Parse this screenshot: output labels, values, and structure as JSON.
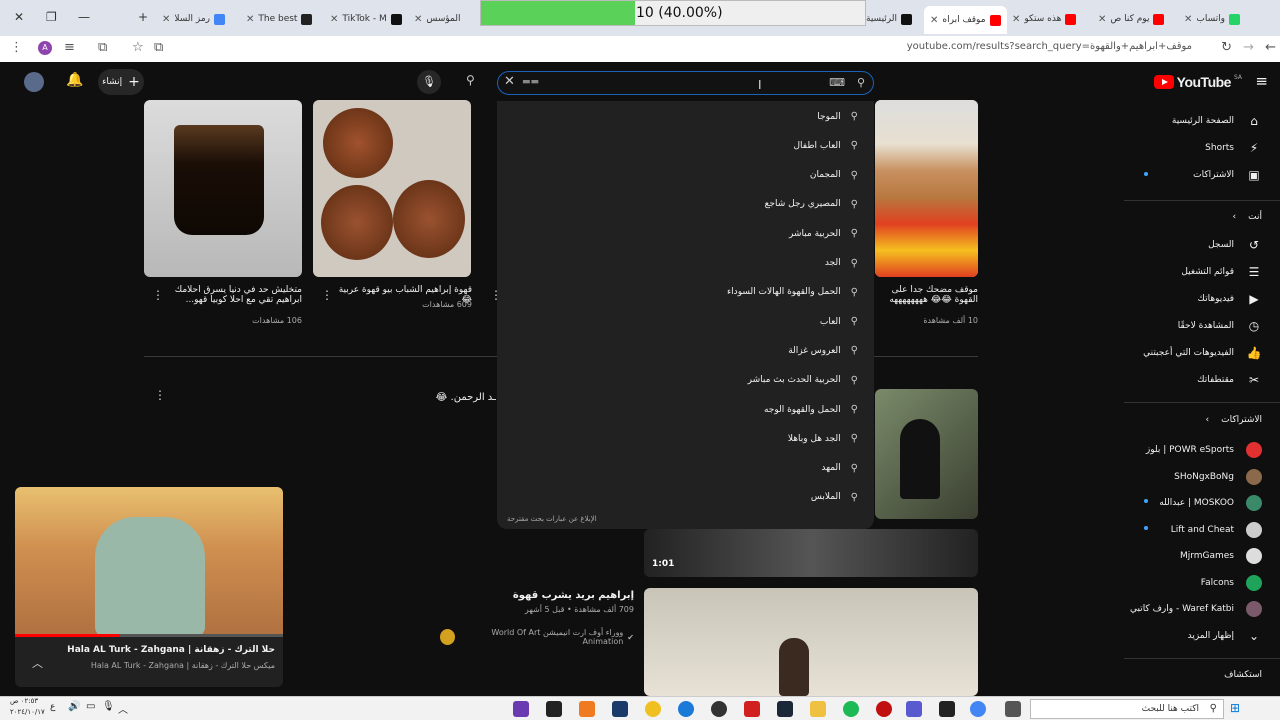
{
  "browser": {
    "tabs": [
      {
        "label": "واتساب",
        "color": "#25d366"
      },
      {
        "label": "يوم كنا ص",
        "color": "#ff0000"
      },
      {
        "label": "هذه ستكو",
        "color": "#ff0000"
      },
      {
        "label": "موقف ابراه",
        "color": "#ff0000"
      },
      {
        "label": "الرئيسية",
        "color": "#000000"
      },
      {
        "label": "المؤسس",
        "color": "#888888"
      },
      {
        "label": "TikTok - M",
        "color": "#000000"
      },
      {
        "label": "The best",
        "color": "#000000"
      },
      {
        "label": "رمز السلا",
        "color": "#4285f4"
      }
    ],
    "progress_text": "10 (40.00%)",
    "progress_value": 0.4,
    "url": "youtube.com/results?search_query=موقف+ابراهيم+والقهوة",
    "profile_initial": "A"
  },
  "header": {
    "logo_text": "YouTube",
    "logo_region": "SA",
    "create_label": "إنشاء",
    "search_value": "▬▬"
  },
  "suggestions": {
    "items": [
      "الموجا",
      "العاب اطفال",
      "المجمان",
      "المصيري رجل شاجع",
      "الحربية مباشر",
      "الجد",
      "الحمل والقهوة الهالات السوداء",
      "العاب",
      "العروس غزالة",
      "الحربية الحدث بث مباشر",
      "الحمل والقهوة الوجه",
      "الجد هل وباهلا",
      "المهد",
      "الملابس"
    ],
    "report_text": "الإبلاغ عن عبارات بحث مقترحة"
  },
  "sidebar": {
    "main": [
      {
        "label": "الصفحة الرئيسية",
        "icon": "home-icon",
        "glyph": "⌂"
      },
      {
        "label": "Shorts",
        "icon": "shorts-icon",
        "glyph": "⚡"
      },
      {
        "label": "الاشتراكات",
        "icon": "subscriptions-icon",
        "glyph": "▣"
      }
    ],
    "you_heading": "أنت",
    "you": [
      {
        "label": "السجل",
        "icon": "history-icon",
        "glyph": "↺"
      },
      {
        "label": "قوائم التشغيل",
        "icon": "playlists-icon",
        "glyph": "☰"
      },
      {
        "label": "فيديوهاتك",
        "icon": "your-videos-icon",
        "glyph": "▶"
      },
      {
        "label": "المشاهدة لاحقًا",
        "icon": "watch-later-icon",
        "glyph": "◷"
      },
      {
        "label": "الفيديوهات التي أعجبتني",
        "icon": "liked-icon",
        "glyph": "👍"
      },
      {
        "label": "مقتطفاتك",
        "icon": "clips-icon",
        "glyph": "✂"
      }
    ],
    "subs_heading": "الاشتراكات",
    "subs": [
      {
        "label": "بلوز | POWR eSports",
        "color": "#e03030"
      },
      {
        "label": "SHoNgxBoNg",
        "color": "#8a6a4a"
      },
      {
        "label": "عبدالله | MOSKOO",
        "color": "#3a8a6a"
      },
      {
        "label": "Lift and Cheat",
        "color": "#cccccc"
      },
      {
        "label": "MjrmGames",
        "color": "#dddddd"
      },
      {
        "label": "Falcons",
        "color": "#1fa35a"
      },
      {
        "label": "وارف كاتبي - Waref Katbi",
        "color": "#7a5a6a"
      }
    ],
    "show_more": "إظهار المزيد",
    "explore": "استكشاف"
  },
  "videos": [
    {
      "title": "موقف مضحك جدا على القهوة 😂😂 ههههههههه",
      "views": "10 ألف مشاهدة"
    },
    {
      "title": "قهوة إبراهيم الشباب بيو قهوة عربية 😂",
      "views": "609 مشاهدات"
    },
    {
      "title": "متخليش حد في دنيا يسرق احلامك ابراهيم تقي مع احلا كوبيا قهو...",
      "views": "106 مشاهدات"
    },
    {
      "title": "ـد الرحمن. 😂"
    },
    {
      "title": "إبراهيم بريد يشرب قهوة",
      "views": "709 ألف مشاهدة • قبل 5 أشهر",
      "channel": "ووراء أوف ارت انيميشن World Of Art Animation"
    }
  ],
  "duration": "1:01",
  "mini_player": {
    "title": "حلا الترك - زهقانة | Hala AL Turk - Zahgana",
    "subtitle": "ميكس حلا الترك - زهقانة | Hala AL Turk - Zahgana"
  },
  "taskbar": {
    "search_placeholder": "اكتب هنا للبحث",
    "time": "٠٢:٥٣ ص",
    "date": "٢٠٢٤/١٠/١٧",
    "lang": "ع"
  }
}
